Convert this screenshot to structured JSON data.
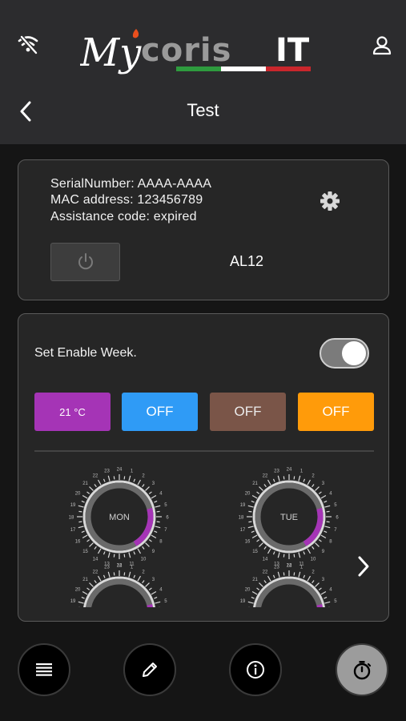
{
  "header": {
    "title": "Test",
    "logo_text": "MyCorisIT",
    "icons": {
      "wifi": "wifi-off-icon",
      "user": "user-icon",
      "back": "chevron-left-icon"
    }
  },
  "device": {
    "serial_number": "SerialNumber: AAAA-AAAA",
    "mac_address": "MAC address: 123456789",
    "assistance_code": "Assistance code: expired",
    "name": "AL12",
    "settings_icon": "gear-icon",
    "power_icon": "power-icon"
  },
  "week": {
    "label": "Set Enable Week.",
    "enabled": true,
    "modes": [
      {
        "label": "21 °C",
        "color": "#a534b6"
      },
      {
        "label": "OFF",
        "color": "#2f9bf6"
      },
      {
        "label": "OFF",
        "color": "#7a5548"
      },
      {
        "label": "OFF",
        "color": "#ff9b0a"
      }
    ],
    "days": [
      "MON",
      "TUE"
    ],
    "next_icon": "chevron-right-icon"
  },
  "bottom_nav": [
    {
      "name": "list-icon",
      "active": false
    },
    {
      "name": "edit-icon",
      "active": false
    },
    {
      "name": "info-icon",
      "active": false
    },
    {
      "name": "timer-icon",
      "active": true
    }
  ],
  "colors": {
    "header_bg": "#2c2c2e",
    "card_bg": "#262626",
    "accent_purple": "#a534b6"
  }
}
